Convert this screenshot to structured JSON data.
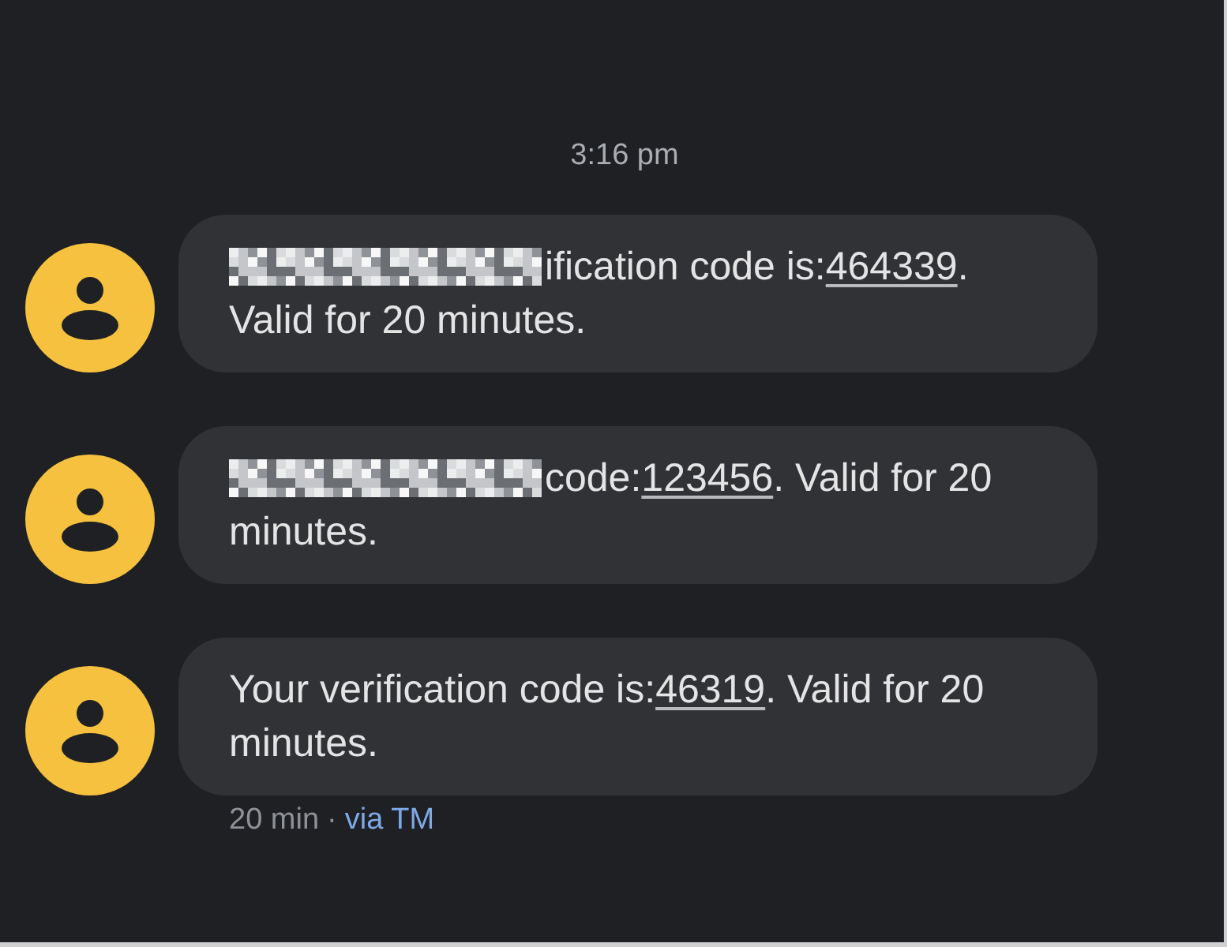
{
  "timestamp": "3:16 pm",
  "messages": [
    {
      "redacted": true,
      "text_before": "ification code is:",
      "code": "464339",
      "text_after": ". Valid for 20 minutes."
    },
    {
      "redacted": true,
      "text_before": "code:",
      "code": "123456",
      "text_after": ". Valid for 20 minutes."
    },
    {
      "redacted": false,
      "text_before": "Your verification code is:",
      "code": "46319",
      "text_after": ". Valid for 20 minutes.",
      "status": {
        "time": "20 min",
        "separator": "·",
        "via": "via TM"
      }
    }
  ]
}
